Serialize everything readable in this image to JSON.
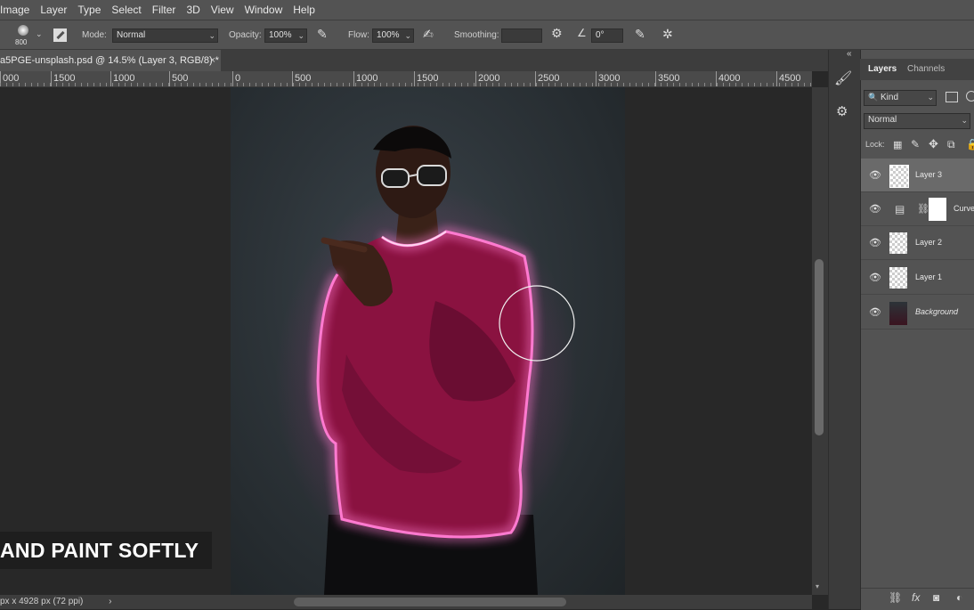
{
  "menu": [
    "Image",
    "Layer",
    "Type",
    "Select",
    "Filter",
    "3D",
    "View",
    "Window",
    "Help"
  ],
  "options": {
    "brush_size": "800",
    "mode_label": "Mode:",
    "mode_value": "Normal",
    "opacity_label": "Opacity:",
    "opacity_value": "100%",
    "flow_label": "Flow:",
    "flow_value": "100%",
    "smoothing_label": "Smoothing:",
    "smoothing_value": "",
    "angle_value": "0°"
  },
  "document": {
    "tab_title": "a5PGE-unsplash.psd @ 14.5% (Layer 3, RGB/8) *",
    "close": "×",
    "status": "px x 4928 px (72 ppi)",
    "status_arrow": "›"
  },
  "ruler": {
    "labels": [
      "000",
      "1500",
      "1000",
      "500",
      "0",
      "500",
      "1000",
      "1500",
      "2000",
      "2500",
      "3000",
      "3500",
      "4000",
      "4500"
    ]
  },
  "caption": "AND PAINT SOFTLY",
  "panel": {
    "collapse": "«",
    "tabs": [
      "Layers",
      "Channels"
    ],
    "filter_kind": "Kind",
    "blend_mode": "Normal",
    "lock_label": "Lock:",
    "layers": [
      {
        "name": "Layer 3",
        "type": "pixel",
        "selected": true
      },
      {
        "name": "Curves",
        "type": "adjustment",
        "selected": false
      },
      {
        "name": "Layer 2",
        "type": "pixel",
        "selected": false
      },
      {
        "name": "Layer 1",
        "type": "pixel",
        "selected": false
      },
      {
        "name": "Background",
        "type": "background",
        "selected": false
      }
    ]
  },
  "colors": {
    "neon": "#ff2fb0",
    "sweater": "#8a1240",
    "panel_bg": "#535353",
    "canvas_bg": "#282828"
  }
}
